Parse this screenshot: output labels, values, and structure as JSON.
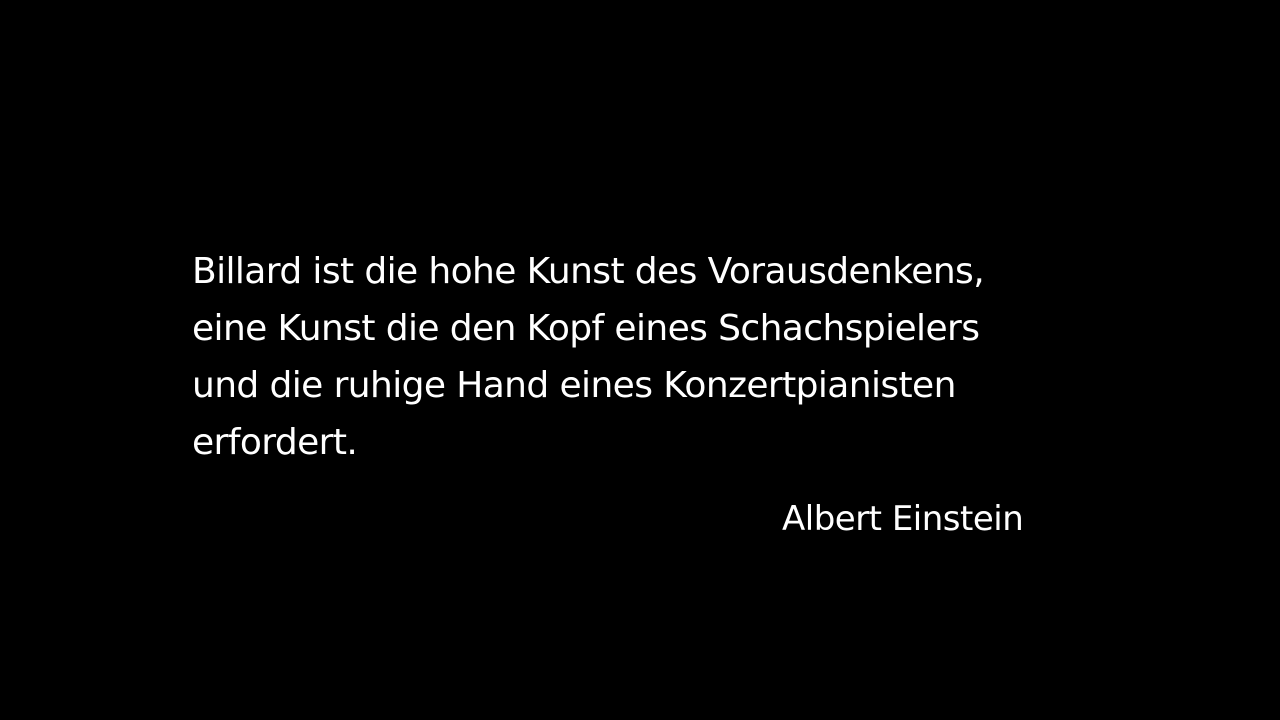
{
  "background_color": "#000000",
  "text_color": "#ffffff",
  "quote": {
    "lines": [
      "Billard ist die hohe Kunst des Vorausdenkens,",
      "eine Kunst die den Kopf eines Schachspielers",
      "und die ruhige Hand eines Konzertpianisten",
      "erfordert."
    ]
  },
  "author": "Albert Einstein"
}
